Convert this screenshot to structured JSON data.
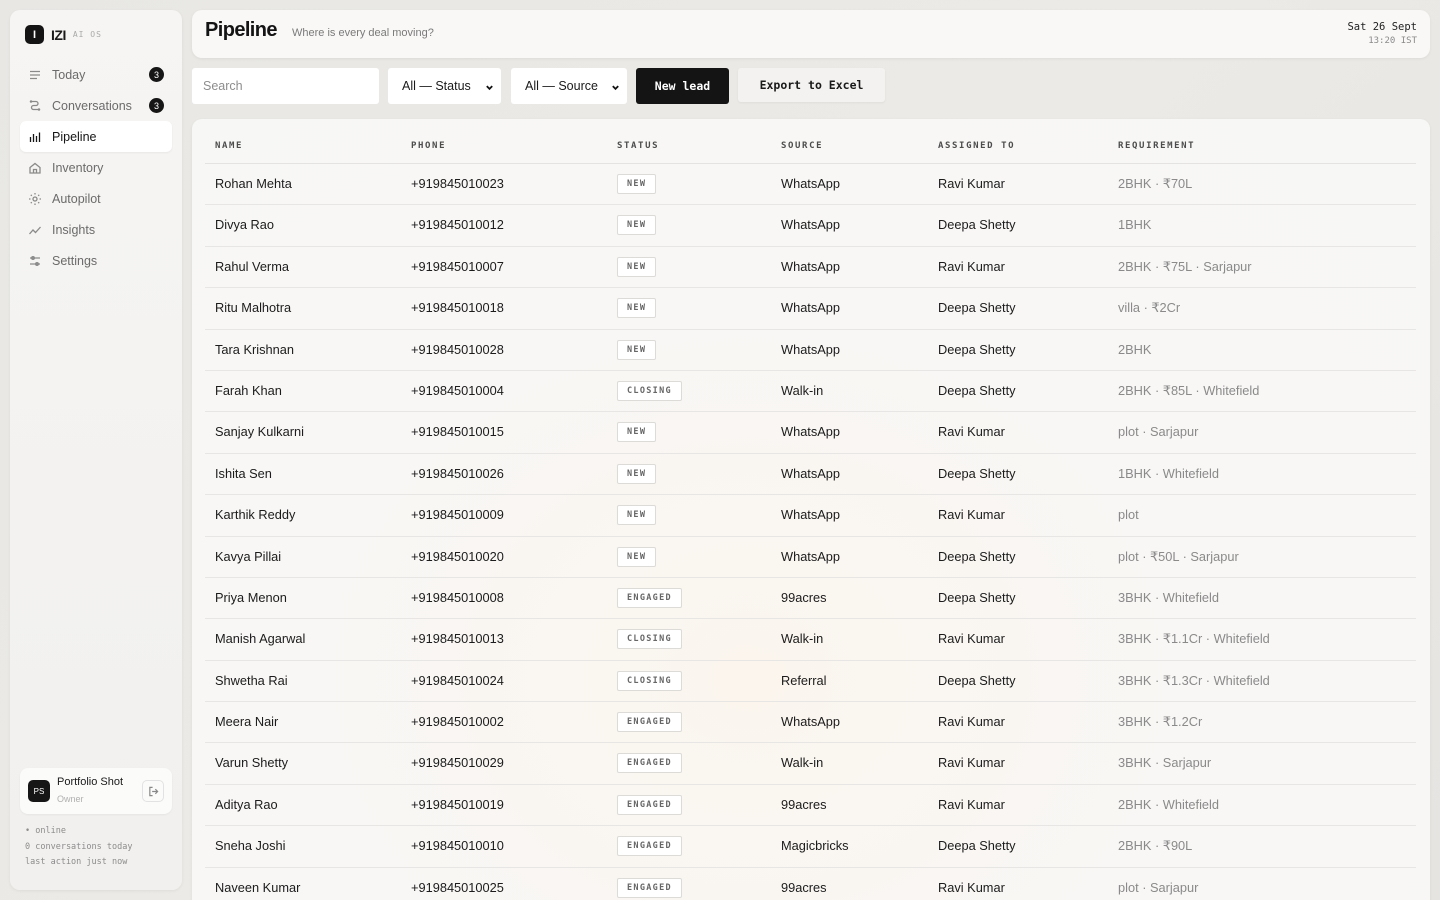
{
  "brand": {
    "mark": "I",
    "name": "IZI",
    "sub": "AI OS"
  },
  "nav": [
    {
      "key": "today",
      "label": "Today",
      "badge": "3",
      "icon": "list-icon"
    },
    {
      "key": "conversations",
      "label": "Conversations",
      "badge": "3",
      "icon": "chat-icon"
    },
    {
      "key": "pipeline",
      "label": "Pipeline",
      "badge": "",
      "icon": "bar-chart-icon",
      "active": true
    },
    {
      "key": "inventory",
      "label": "Inventory",
      "badge": "",
      "icon": "home-icon"
    },
    {
      "key": "autopilot",
      "label": "Autopilot",
      "badge": "",
      "icon": "sun-icon"
    },
    {
      "key": "insights",
      "label": "Insights",
      "badge": "",
      "icon": "trend-icon"
    },
    {
      "key": "settings",
      "label": "Settings",
      "badge": "",
      "icon": "sliders-icon"
    }
  ],
  "user": {
    "initials": "PS",
    "name": "Portfolio Shot",
    "role": "Owner"
  },
  "system_status": {
    "online": "• online",
    "conversations": "0 conversations today",
    "last_action": "last action just now"
  },
  "header": {
    "title": "Pipeline",
    "subtitle": "Where is every deal moving?",
    "date": "Sat 26 Sept",
    "time": "13:20 IST"
  },
  "toolbar": {
    "search_placeholder": "Search",
    "status_filter": "All — Status",
    "source_filter": "All — Source",
    "new_lead": "New lead",
    "export": "Export to Excel"
  },
  "table": {
    "columns": [
      "NAME",
      "PHONE",
      "STATUS",
      "SOURCE",
      "ASSIGNED TO",
      "REQUIREMENT"
    ],
    "rows": [
      {
        "name": "Rohan Mehta",
        "phone": "+919845010023",
        "status": "NEW",
        "source": "WhatsApp",
        "assigned": "Ravi Kumar",
        "req": "2BHK · ₹70L"
      },
      {
        "name": "Divya Rao",
        "phone": "+919845010012",
        "status": "NEW",
        "source": "WhatsApp",
        "assigned": "Deepa Shetty",
        "req": "1BHK"
      },
      {
        "name": "Rahul Verma",
        "phone": "+919845010007",
        "status": "NEW",
        "source": "WhatsApp",
        "assigned": "Ravi Kumar",
        "req": "2BHK · ₹75L · Sarjapur"
      },
      {
        "name": "Ritu Malhotra",
        "phone": "+919845010018",
        "status": "NEW",
        "source": "WhatsApp",
        "assigned": "Deepa Shetty",
        "req": "villa · ₹2Cr"
      },
      {
        "name": "Tara Krishnan",
        "phone": "+919845010028",
        "status": "NEW",
        "source": "WhatsApp",
        "assigned": "Deepa Shetty",
        "req": "2BHK"
      },
      {
        "name": "Farah Khan",
        "phone": "+919845010004",
        "status": "CLOSING",
        "source": "Walk-in",
        "assigned": "Deepa Shetty",
        "req": "2BHK · ₹85L · Whitefield"
      },
      {
        "name": "Sanjay Kulkarni",
        "phone": "+919845010015",
        "status": "NEW",
        "source": "WhatsApp",
        "assigned": "Ravi Kumar",
        "req": "plot · Sarjapur"
      },
      {
        "name": "Ishita Sen",
        "phone": "+919845010026",
        "status": "NEW",
        "source": "WhatsApp",
        "assigned": "Deepa Shetty",
        "req": "1BHK · Whitefield"
      },
      {
        "name": "Karthik Reddy",
        "phone": "+919845010009",
        "status": "NEW",
        "source": "WhatsApp",
        "assigned": "Ravi Kumar",
        "req": "plot"
      },
      {
        "name": "Kavya Pillai",
        "phone": "+919845010020",
        "status": "NEW",
        "source": "WhatsApp",
        "assigned": "Deepa Shetty",
        "req": "plot · ₹50L · Sarjapur"
      },
      {
        "name": "Priya Menon",
        "phone": "+919845010008",
        "status": "ENGAGED",
        "source": "99acres",
        "assigned": "Deepa Shetty",
        "req": "3BHK · Whitefield"
      },
      {
        "name": "Manish Agarwal",
        "phone": "+919845010013",
        "status": "CLOSING",
        "source": "Walk-in",
        "assigned": "Ravi Kumar",
        "req": "3BHK · ₹1.1Cr · Whitefield"
      },
      {
        "name": "Shwetha Rai",
        "phone": "+919845010024",
        "status": "CLOSING",
        "source": "Referral",
        "assigned": "Deepa Shetty",
        "req": "3BHK · ₹1.3Cr · Whitefield"
      },
      {
        "name": "Meera Nair",
        "phone": "+919845010002",
        "status": "ENGAGED",
        "source": "WhatsApp",
        "assigned": "Ravi Kumar",
        "req": "3BHK · ₹1.2Cr"
      },
      {
        "name": "Varun Shetty",
        "phone": "+919845010029",
        "status": "ENGAGED",
        "source": "Walk-in",
        "assigned": "Ravi Kumar",
        "req": "3BHK · Sarjapur"
      },
      {
        "name": "Aditya Rao",
        "phone": "+919845010019",
        "status": "ENGAGED",
        "source": "99acres",
        "assigned": "Ravi Kumar",
        "req": "2BHK · Whitefield"
      },
      {
        "name": "Sneha Joshi",
        "phone": "+919845010010",
        "status": "ENGAGED",
        "source": "Magicbricks",
        "assigned": "Deepa Shetty",
        "req": "2BHK · ₹90L"
      },
      {
        "name": "Naveen Kumar",
        "phone": "+919845010025",
        "status": "ENGAGED",
        "source": "99acres",
        "assigned": "Ravi Kumar",
        "req": "plot · Sarjapur"
      }
    ]
  }
}
